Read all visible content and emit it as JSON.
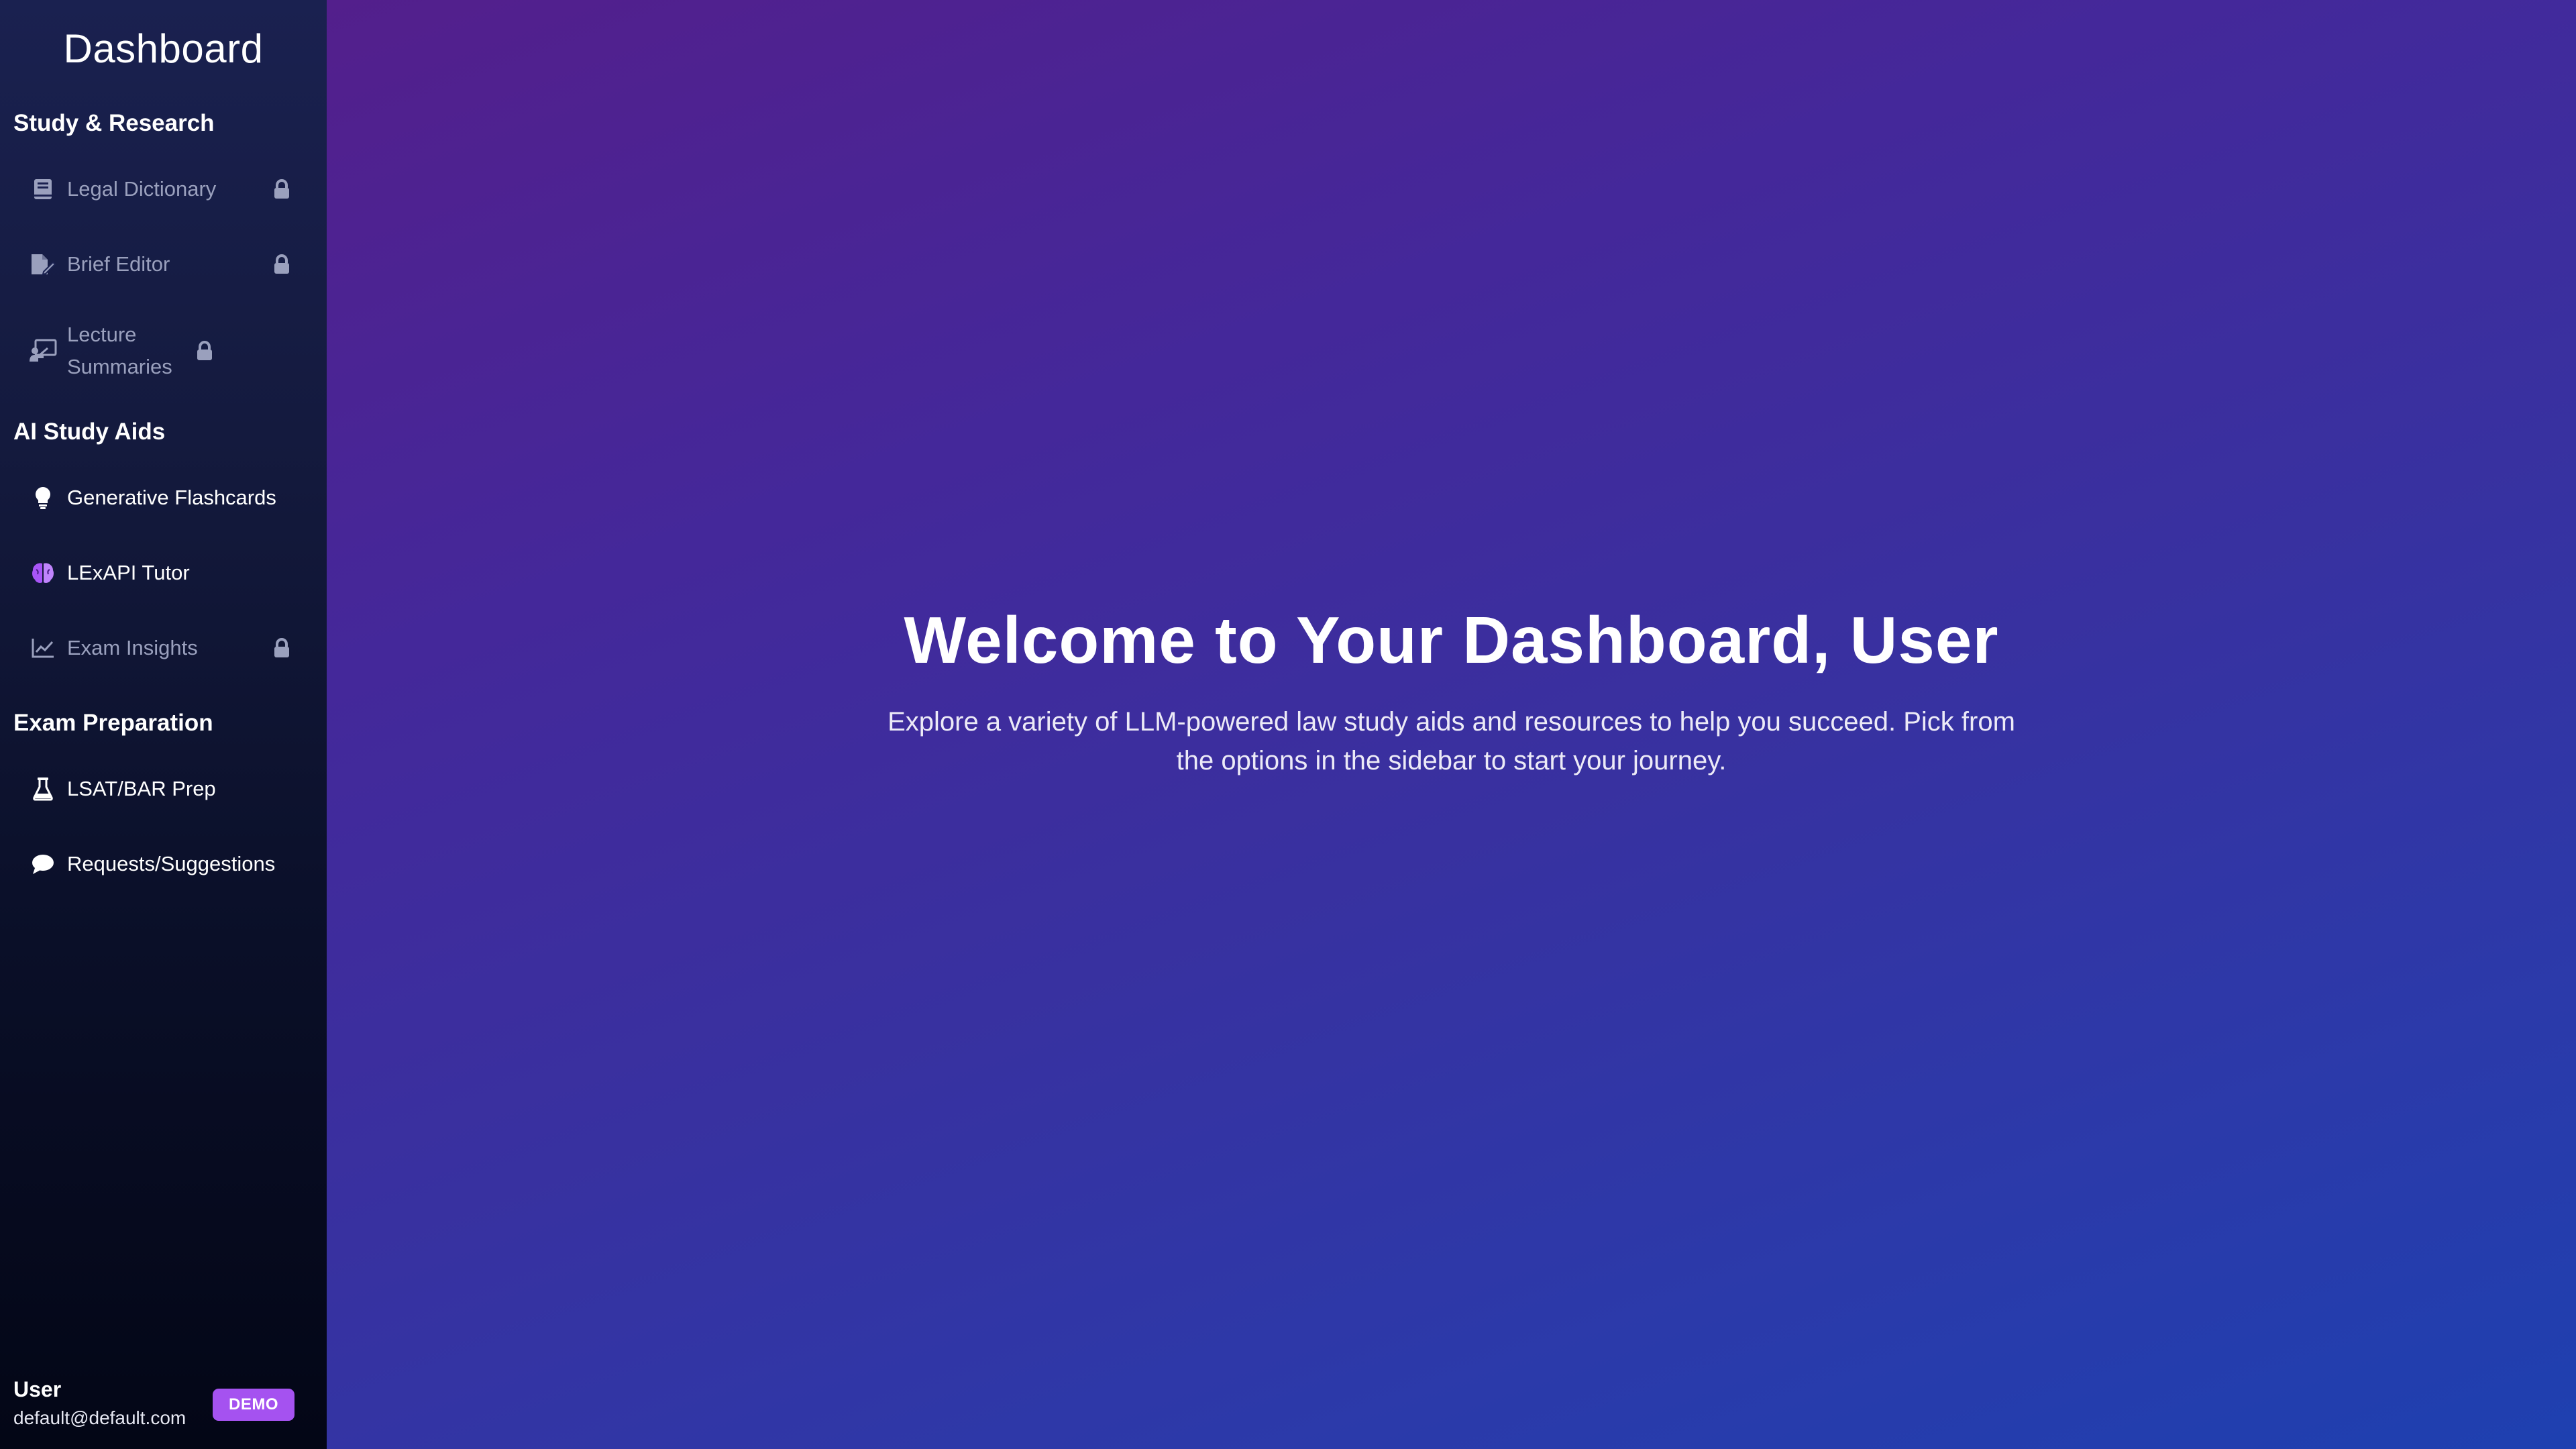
{
  "sidebar": {
    "title": "Dashboard",
    "sections": [
      {
        "heading": "Study & Research",
        "items": [
          {
            "label": "Legal Dictionary",
            "icon": "book-icon",
            "locked": true
          },
          {
            "label": "Brief Editor",
            "icon": "file-edit-icon",
            "locked": true
          },
          {
            "label": "Lecture Summaries",
            "icon": "chalkboard-icon",
            "locked": true
          }
        ]
      },
      {
        "heading": "AI Study Aids",
        "items": [
          {
            "label": "Generative Flashcards",
            "icon": "lightbulb-icon",
            "locked": false
          },
          {
            "label": "LExAPI Tutor",
            "icon": "brain-icon",
            "locked": false
          },
          {
            "label": "Exam Insights",
            "icon": "chart-line-icon",
            "locked": true
          }
        ]
      },
      {
        "heading": "Exam Preparation",
        "items": [
          {
            "label": "LSAT/BAR Prep",
            "icon": "flask-icon",
            "locked": false
          },
          {
            "label": "Requests/Suggestions",
            "icon": "comment-icon",
            "locked": false
          }
        ]
      }
    ],
    "user": {
      "name": "User",
      "email": "default@default.com",
      "badge": "DEMO"
    }
  },
  "main": {
    "title": "Welcome to Your Dashboard, User",
    "subtitle": "Explore a variety of LLM-powered law study aids and resources to help you succeed. Pick from the options in the sidebar to start your journey."
  },
  "colors": {
    "badge": "#a552f0",
    "brain_icon": "#a855f7",
    "locked_text": "#9aa0bd"
  }
}
